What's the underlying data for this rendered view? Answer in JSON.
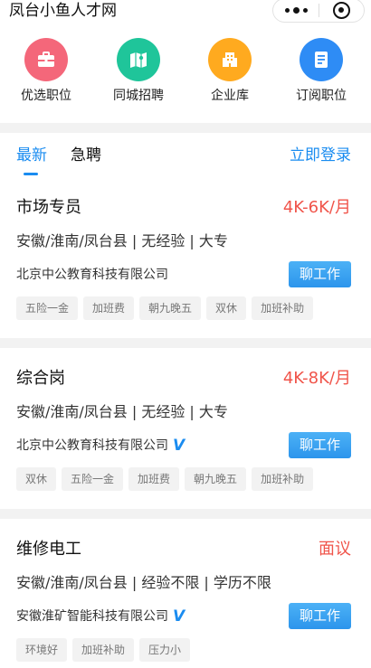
{
  "header": {
    "app_title": "凤台小鱼人才网",
    "more_icon": "more-dots-icon",
    "close_icon": "target-circle-icon"
  },
  "quick_nav": [
    {
      "label": "优选职位",
      "icon": "briefcase-icon",
      "color": "#f4677a"
    },
    {
      "label": "同城招聘",
      "icon": "map-icon",
      "color": "#1fc59a"
    },
    {
      "label": "企业库",
      "icon": "building-icon",
      "color": "#ffaa1f"
    },
    {
      "label": "订阅职位",
      "icon": "document-icon",
      "color": "#2e8cf5"
    }
  ],
  "tabs": {
    "latest": "最新",
    "urgent": "急聘",
    "login": "立即登录"
  },
  "colors": {
    "accent": "#1a8cf0",
    "salary": "#f0544a",
    "tag_bg": "#f2f2f2"
  },
  "jobs": [
    {
      "title": "市场专员",
      "salary": "4K-6K/月",
      "meta": "安徽/淮南/凤台县 | 无经验 | 大专",
      "company": "北京中公教育科技有限公司",
      "verified": false,
      "chat_label": "聊工作",
      "tags": [
        "五险一金",
        "加班费",
        "朝九晚五",
        "双休",
        "加班补助"
      ]
    },
    {
      "title": "综合岗",
      "salary": "4K-8K/月",
      "meta": "安徽/淮南/凤台县 | 无经验 | 大专",
      "company": "北京中公教育科技有限公司",
      "verified": true,
      "verified_mark": "V",
      "chat_label": "聊工作",
      "tags": [
        "双休",
        "五险一金",
        "加班费",
        "朝九晚五",
        "加班补助"
      ]
    },
    {
      "title": "维修电工",
      "salary": "面议",
      "meta": "安徽/淮南/凤台县 | 经验不限 | 学历不限",
      "company": "安徽淮矿智能科技有限公司",
      "verified": true,
      "verified_mark": "V",
      "chat_label": "聊工作",
      "tags": [
        "环境好",
        "加班补助",
        "压力小"
      ]
    }
  ]
}
